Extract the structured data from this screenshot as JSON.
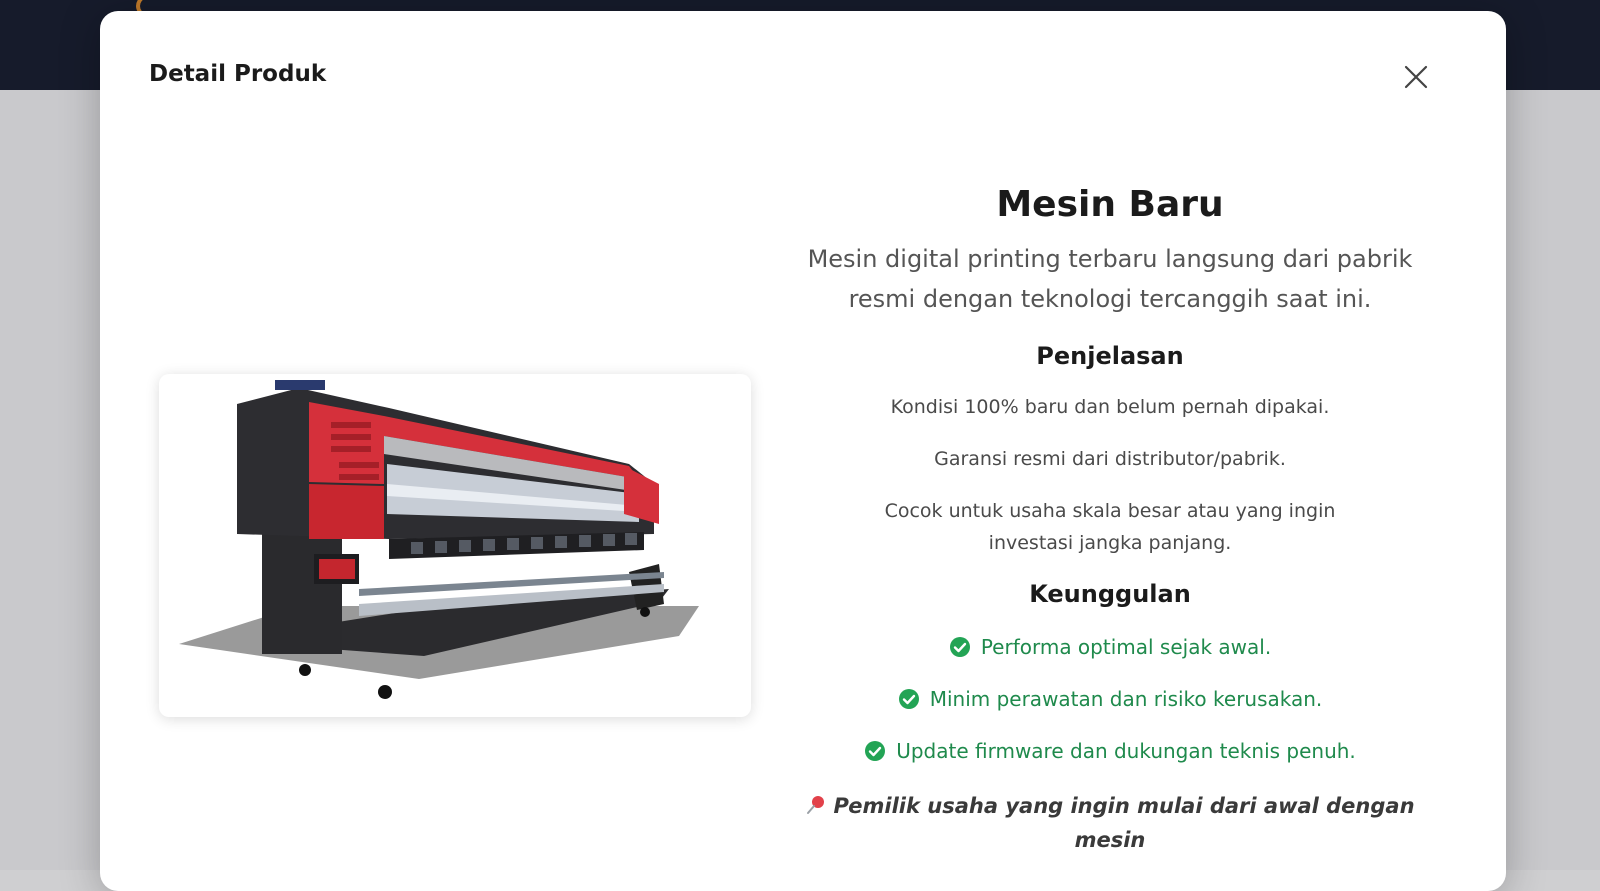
{
  "modal": {
    "title": "Detail Produk",
    "close_icon": "close-icon"
  },
  "product": {
    "name": "Mesin Baru",
    "subtitle": "Mesin digital printing terbaru langsung dari pabrik resmi dengan teknologi tercanggih saat ini.",
    "image_icon": "printer-image"
  },
  "penjelasan": {
    "heading": "Penjelasan",
    "items": [
      "Kondisi 100% baru dan belum pernah dipakai.",
      "Garansi resmi dari distributor/pabrik.",
      "Cocok untuk usaha skala besar atau yang ingin investasi jangka panjang."
    ]
  },
  "keunggulan": {
    "heading": "Keunggulan",
    "items": [
      "Performa optimal sejak awal.",
      "Minim perawatan dan risiko kerusakan.",
      "Update firmware dan dukungan teknis penuh."
    ],
    "icon": "check-circle-icon",
    "color": "#1f8a4c"
  },
  "note": {
    "icon": "pushpin-icon",
    "text": "Pemilik usaha yang ingin mulai dari awal dengan mesin"
  },
  "colors": {
    "topbar": "#161b2b",
    "accent_green": "#1f8a4c",
    "pin_red": "#e2414a"
  }
}
